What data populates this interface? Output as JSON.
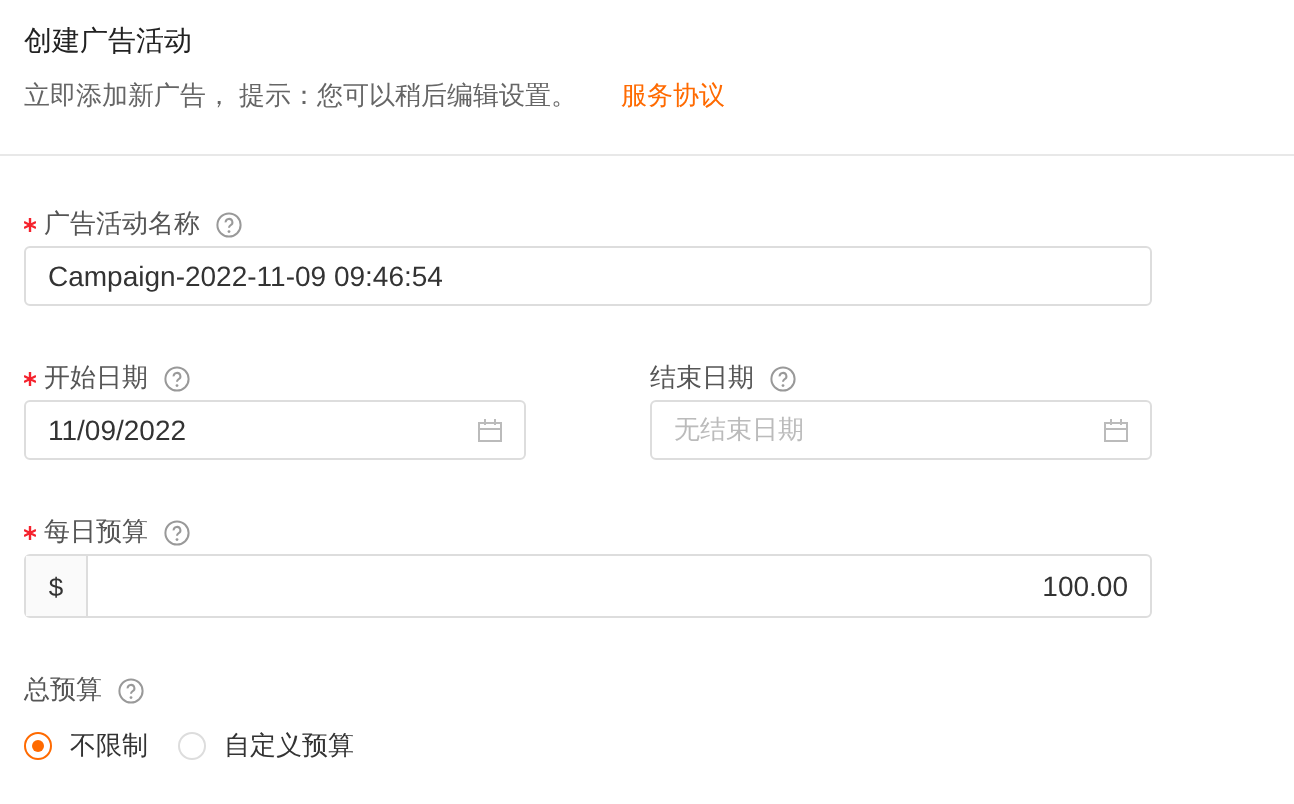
{
  "header": {
    "title": "创建广告活动",
    "subtitle": "立即添加新广告， 提示：您可以稍后编辑设置。",
    "link": "服务协议"
  },
  "fields": [
    {
      "kind": "text",
      "label": "广告活动名称",
      "required": true,
      "value": "Campaign-2022-11-09 09:46:54"
    },
    {
      "kind": "dates",
      "items": [
        {
          "label": "开始日期",
          "required": true,
          "value": "11/09/2022"
        },
        {
          "label": "结束日期",
          "required": false,
          "placeholder": "无结束日期"
        }
      ]
    },
    {
      "kind": "money",
      "label": "每日预算",
      "required": true,
      "prefix": "$",
      "value": "100.00"
    },
    {
      "kind": "radio",
      "label": "总预算",
      "required": false,
      "options": [
        {
          "label": "不限制",
          "selected": true
        },
        {
          "label": "自定义预算",
          "selected": false
        }
      ]
    }
  ]
}
